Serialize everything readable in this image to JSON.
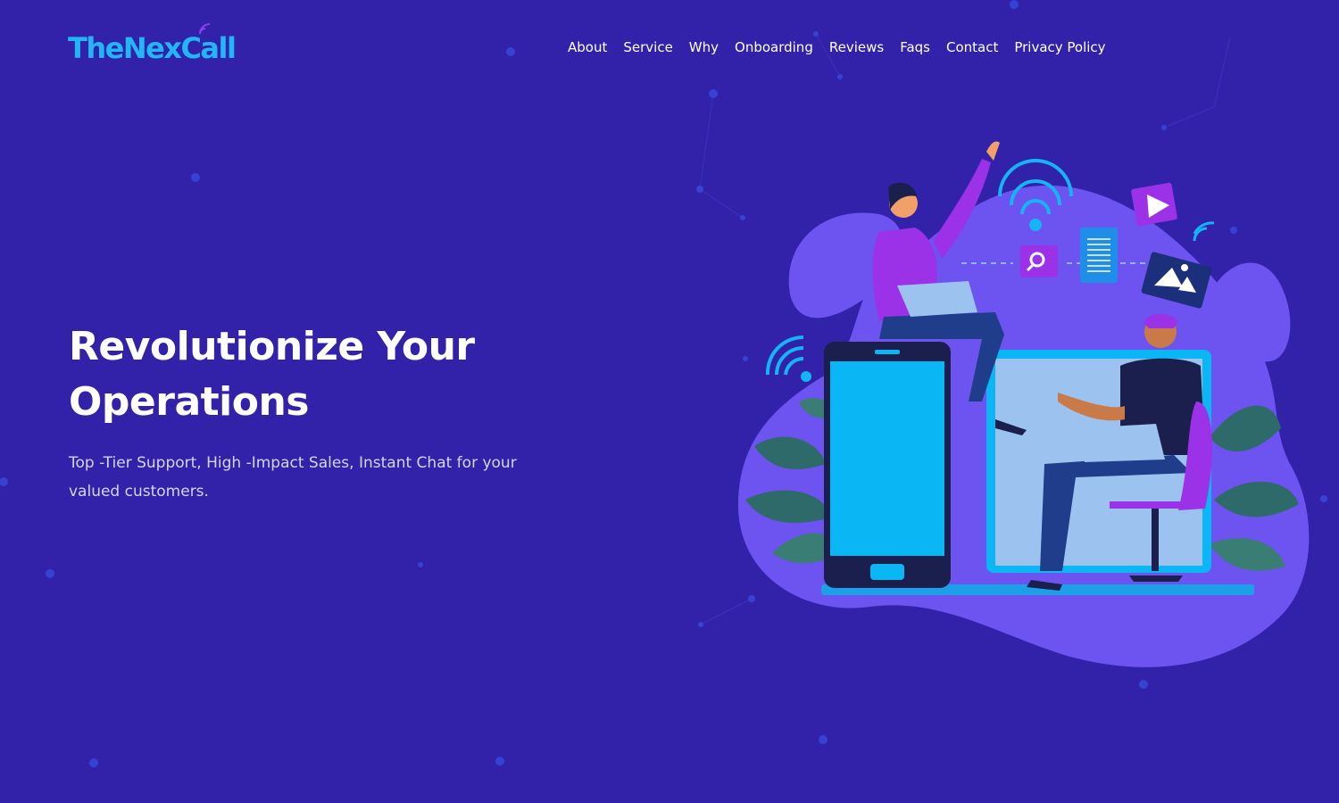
{
  "brand": {
    "name": "TheNexCall",
    "part1": "TheNex",
    "part2": "Call",
    "color": "#23b6f4",
    "signal_color": "#8a3ff0"
  },
  "nav": {
    "items": [
      {
        "label": "About"
      },
      {
        "label": "Service"
      },
      {
        "label": "Why"
      },
      {
        "label": "Onboarding"
      },
      {
        "label": "Reviews"
      },
      {
        "label": "Faqs"
      },
      {
        "label": "Contact"
      },
      {
        "label": "Privacy Policy"
      }
    ]
  },
  "hero": {
    "title": "Revolutionize Your Operations",
    "subtitle": "Top -Tier Support, High -Impact Sales, Instant Chat for your valued customers."
  },
  "colors": {
    "background": "#3222a9",
    "blob": "#6d53f0",
    "phone_screen": "#0bb6f4",
    "accent_purple": "#9b32e8",
    "dark_navy": "#1b1f4d"
  },
  "icons": {
    "search": "search-icon",
    "document": "document-icon",
    "play": "play-icon",
    "image": "image-icon",
    "wifi": "wifi-icon"
  }
}
